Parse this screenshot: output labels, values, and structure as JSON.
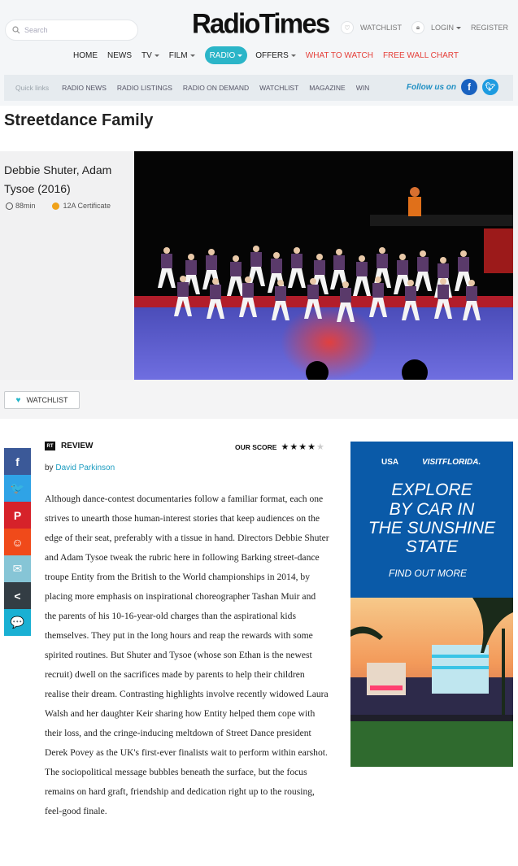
{
  "header": {
    "search_placeholder": "Search",
    "logo": "RadioTimes",
    "watchlist": "WATCHLIST",
    "login": "LOGIN",
    "register": "REGISTER"
  },
  "nav": {
    "items": [
      {
        "label": "HOME",
        "caret": false,
        "style": "normal"
      },
      {
        "label": "NEWS",
        "caret": false,
        "style": "normal"
      },
      {
        "label": "TV",
        "caret": true,
        "style": "normal"
      },
      {
        "label": "FILM",
        "caret": true,
        "style": "normal"
      },
      {
        "label": "RADIO",
        "caret": true,
        "style": "active"
      },
      {
        "label": "OFFERS",
        "caret": true,
        "style": "normal"
      },
      {
        "label": "WHAT TO WATCH",
        "caret": false,
        "style": "red"
      },
      {
        "label": "FREE WALL CHART",
        "caret": false,
        "style": "red"
      }
    ]
  },
  "quicklinks": {
    "label": "Quick links",
    "items": [
      "RADIO NEWS",
      "RADIO LISTINGS",
      "RADIO ON DEMAND",
      "WATCHLIST",
      "MAGAZINE",
      "WIN"
    ],
    "follow_label": "Follow us on"
  },
  "page": {
    "title": "Streetdance Family",
    "credits": "Debbie Shuter, Adam Tysoe (2016)",
    "runtime": "88min",
    "certificate": "12A Certificate",
    "watchlist_button": "WATCHLIST"
  },
  "review": {
    "heading": "REVIEW",
    "rt_badge": "RT",
    "score_label": "OUR SCORE",
    "stars_filled": 4,
    "stars_total": 5,
    "by_prefix": "by",
    "author": "David Parkinson",
    "text": "Although dance-contest documentaries follow a familiar format, each one strives to unearth those human-interest stories that keep audiences on the edge of their seat, preferably with a tissue in hand. Directors Debbie Shuter and Adam Tysoe tweak the rubric here in following Barking street-dance troupe Entity from the British to the World championships in 2014, by placing more emphasis on inspirational choreographer Tashan Muir and the parents of his 10-16-year-old charges than the aspirational kids themselves. They put in the long hours and reap the rewards with some spirited routines. But Shuter and Tysoe (whose son Ethan is the newest recruit) dwell on the sacrifices made by parents to help their children realise their dream. Contrasting highlights involve recently widowed Laura Walsh and her daughter Keir sharing how Entity helped them cope with their loss, and the cringe-inducing meltdown of Street Dance president Derek Povey as the UK's first-ever finalists wait to perform within earshot. The sociopolitical message bubbles beneath the surface, but the focus remains on hard graft, friendship and dedication right up to the rousing, feel-good finale."
  },
  "share": [
    {
      "icon": "facebook-icon",
      "glyph": "f",
      "color": "#3b5998"
    },
    {
      "icon": "twitter-icon",
      "glyph": "🐦",
      "color": "#2fa3e6"
    },
    {
      "icon": "pinterest-icon",
      "glyph": "P",
      "color": "#d6222a"
    },
    {
      "icon": "reddit-icon",
      "glyph": "☺",
      "color": "#f04a1a"
    },
    {
      "icon": "email-icon",
      "glyph": "✉",
      "color": "#86c5d6"
    },
    {
      "icon": "share-icon",
      "glyph": "<",
      "color": "#333d44"
    },
    {
      "icon": "comments-icon",
      "glyph": "💬",
      "color": "#1ab0d3"
    }
  ],
  "ad": {
    "brand_left": "USA",
    "brand_right": "VISITFLORIDA.",
    "headline": [
      "EXPLORE",
      "BY CAR IN",
      "THE SUNSHINE",
      "STATE"
    ],
    "cta": "FIND OUT MORE",
    "bg": "#0a5aa8"
  },
  "colors": {
    "accent": "#2bb5c8",
    "red_links": "#e5403a",
    "author_link": "#1b9cc0"
  }
}
